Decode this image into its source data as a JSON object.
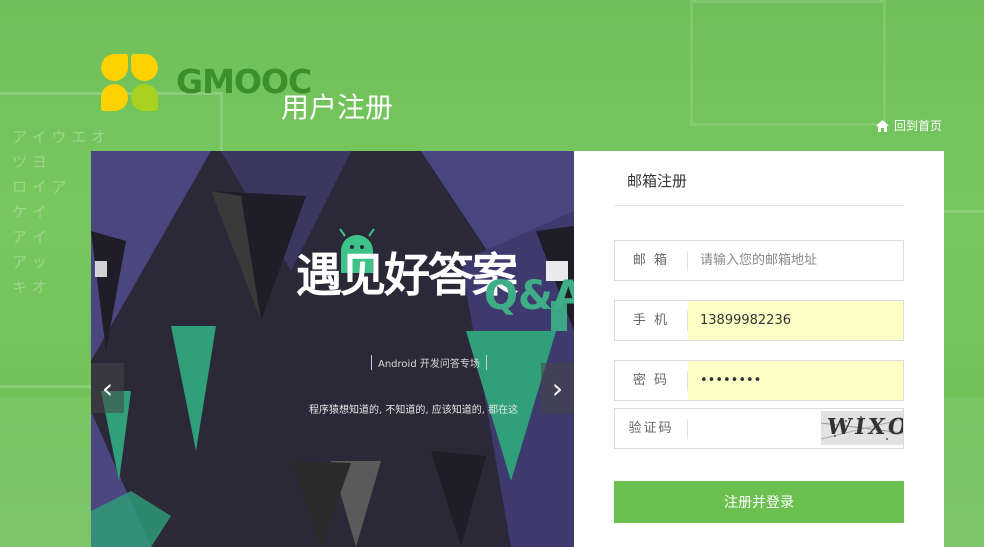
{
  "brand": {
    "logo_text": "GMOOC",
    "logo_colors": [
      "#ffd100",
      "#ffd100",
      "#a8d21f",
      "#a8d21f"
    ]
  },
  "header": {
    "title": "用户注册",
    "home_link": "回到首页"
  },
  "carousel": {
    "title": "遇见好答案",
    "subtitle": "Android 开发问答专场",
    "caption": "程序猿想知道的, 不知道的, 应该知道的, 都在这",
    "qa_text": "Q&A",
    "prev_icon": "chevron-left-icon",
    "next_icon": "chevron-right-icon"
  },
  "form": {
    "tab_label": "邮箱注册",
    "email": {
      "label": "邮 箱",
      "placeholder": "请输入您的邮箱地址",
      "value": ""
    },
    "phone": {
      "label": "手 机",
      "value": "13899982236"
    },
    "password": {
      "label": "密 码",
      "value": "••••••••"
    },
    "captcha": {
      "label": "验证码",
      "value": "",
      "image_text": "WIXO"
    },
    "submit_label": "注册并登录"
  },
  "colors": {
    "accent": "#6cc04f",
    "brand_dark": "#3c8f2a",
    "autofill": "#fbffc6"
  }
}
